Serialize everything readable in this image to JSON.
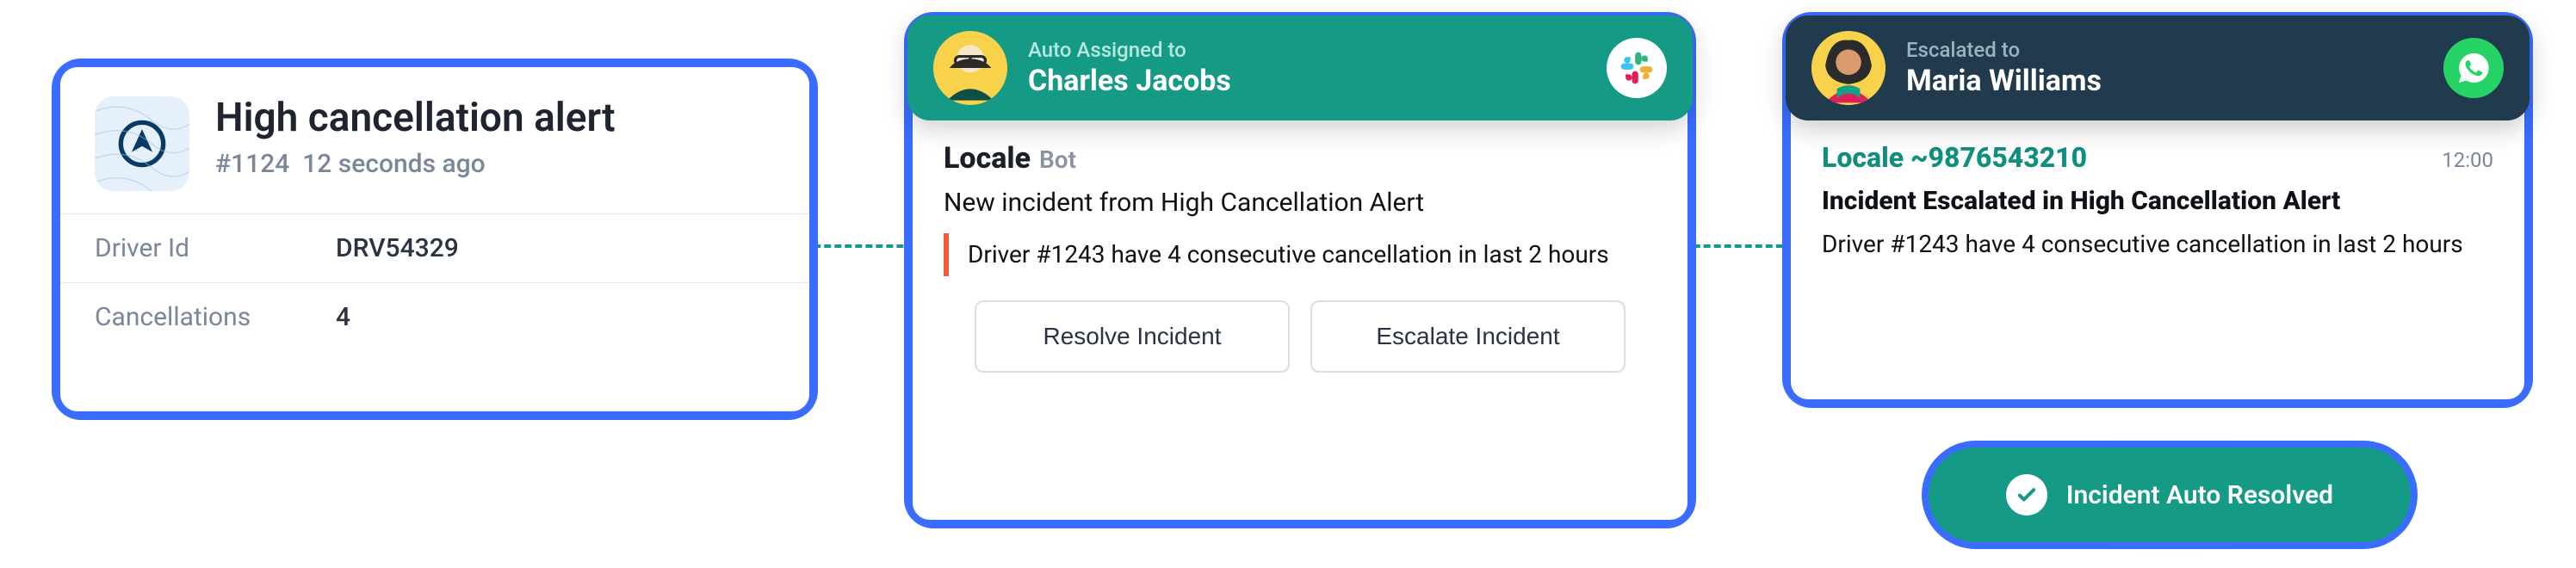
{
  "card1": {
    "title": "High cancellation alert",
    "ticket": "#1124",
    "age": "12 seconds ago",
    "rows": [
      {
        "label": "Driver Id",
        "value": "DRV54329"
      },
      {
        "label": "Cancellations",
        "value": "4"
      }
    ]
  },
  "card2": {
    "header_sub": "Auto Assigned to",
    "header_name": "Charles Jacobs",
    "bot_name": "Locale",
    "bot_tag": "Bot",
    "incident_title": "New incident from High Cancellation Alert",
    "incident_body": "Driver #1243 have 4 consecutive cancellation in last 2 hours",
    "resolve_label": "Resolve Incident",
    "escalate_label": "Escalate Incident"
  },
  "card3": {
    "header_sub": "Escalated to",
    "header_name": "Maria Williams",
    "locale_line": "Locale ~9876543210",
    "timestamp": "12:00",
    "title": "Incident Escalated in High Cancellation Alert",
    "body": "Driver #1243 have 4 consecutive cancellation in last 2 hours"
  },
  "pill": {
    "label": "Incident Auto Resolved"
  }
}
